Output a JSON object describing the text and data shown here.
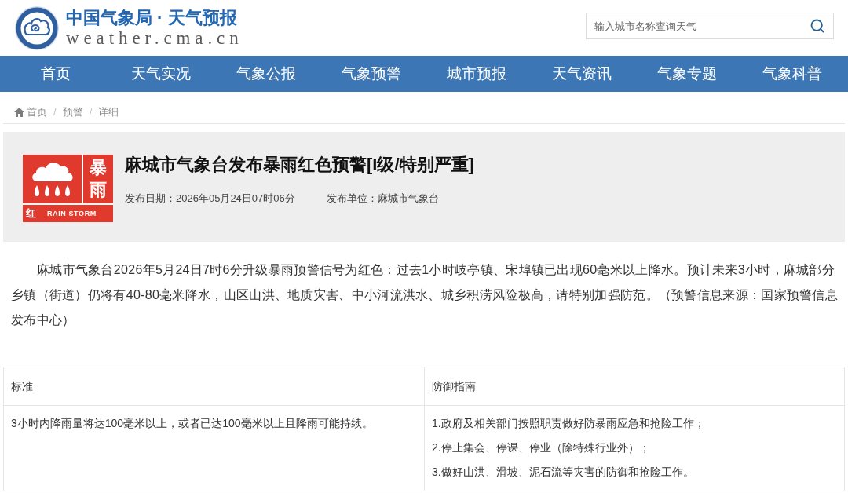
{
  "header": {
    "site_title": "中国气象局 · 天气预报",
    "site_domain": "weather.cma.cn",
    "search": {
      "placeholder": "输入城市名称查询天气"
    }
  },
  "nav": [
    "首页",
    "天气实况",
    "气象公报",
    "气象预警",
    "城市预报",
    "天气资讯",
    "气象专题",
    "气象科普"
  ],
  "breadcrumb": {
    "items": [
      {
        "label": "首页",
        "kind": "home"
      },
      {
        "label": "预警",
        "kind": "link"
      },
      {
        "label": "详细",
        "kind": "current"
      }
    ],
    "separators": [
      "/",
      "/"
    ]
  },
  "warning": {
    "badge": {
      "characters": [
        "暴",
        "雨"
      ],
      "level": "红",
      "english": "RAIN STORM"
    },
    "title": "麻城市气象台发布暴雨红色预警[I级/特别严重]",
    "publish_date": "发布日期：2026年05月24日07时06分",
    "publisher": "发布单位：麻城市气象台"
  },
  "body": "麻城市气象台2026年5月24日7时6分升级暴雨预警信号为红色：过去1小时岐亭镇、宋埠镇已出现60毫米以上降水。预计未来3小时，麻城部分乡镇（街道）仍将有40-80毫米降水，山区山洪、地质灾害、中小河流洪水、城乡积涝风险极高，请特别加强防范。（预警信息来源：国家预警信息发布中心）",
  "table": {
    "columns": [
      "标准",
      "防御指南"
    ],
    "rows": [
      {
        "criteria": "3小时内降雨量将达100毫米以上，或者已达100毫米以上且降雨可能持续。",
        "guidance": [
          "1.政府及相关部门按照职责做好防暴雨应急和抢险工作；",
          "2.停止集会、停课、停业（除特殊行业外）；",
          "3.做好山洪、滑坡、泥石流等灾害的防御和抢险工作。"
        ]
      }
    ]
  }
}
